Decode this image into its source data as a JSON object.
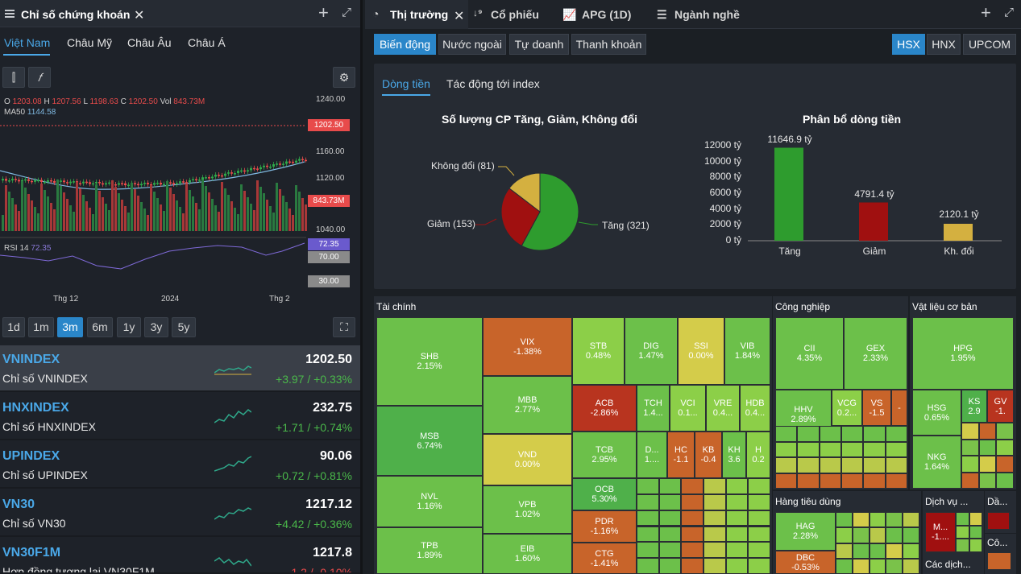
{
  "left_panel": {
    "title": "Chỉ số chứng khoán",
    "regions": [
      "Việt Nam",
      "Châu Mỹ",
      "Châu Âu",
      "Châu Á"
    ],
    "chart": {
      "legend_o_label": "O",
      "legend_o": "1203.08",
      "legend_h_label": "H",
      "legend_h": "1207.56",
      "legend_l_label": "L",
      "legend_l": "1198.63",
      "legend_c_label": "C",
      "legend_c": "1202.50",
      "legend_vol_label": "Vol",
      "legend_vol": "843.73M",
      "ma50_label": "MA50",
      "ma50": "1144.58",
      "rsi_label": "RSI 14",
      "rsi": "72.35",
      "y_ticks": [
        "1240.00",
        "1160.00",
        "1120.00",
        "1040.00"
      ],
      "price_tag": "1202.50",
      "vol_tag": "843.73M",
      "rsi_tag": "72.35",
      "rsi_70": "70.00",
      "rsi_30": "30.00",
      "x_ticks": [
        "Thg 12",
        "2024",
        "Thg 2"
      ]
    },
    "ranges": [
      "1d",
      "1m",
      "3m",
      "6m",
      "1y",
      "3y",
      "5y"
    ],
    "indices": [
      {
        "code": "VNINDEX",
        "name": "Chỉ số VNINDEX",
        "value": "1202.50",
        "change": "+3.97 / +0.33%",
        "dir": "up"
      },
      {
        "code": "HNXINDEX",
        "name": "Chỉ số HNXINDEX",
        "value": "232.75",
        "change": "+1.71 / +0.74%",
        "dir": "up"
      },
      {
        "code": "UPINDEX",
        "name": "Chỉ số UPINDEX",
        "value": "90.06",
        "change": "+0.72 / +0.81%",
        "dir": "up"
      },
      {
        "code": "VN30",
        "name": "Chỉ số VN30",
        "value": "1217.12",
        "change": "+4.42 / +0.36%",
        "dir": "up"
      },
      {
        "code": "VN30F1M",
        "name": "Hợp đồng tương lai VN30F1M",
        "value": "1217.8",
        "change": "-1.2 / -0.10%",
        "dir": "down"
      }
    ]
  },
  "right_panel": {
    "tabs": [
      "Thị trường",
      "Cổ phiếu",
      "APG (1D)",
      "Ngành nghề"
    ],
    "sub_tabs": [
      "Biến động",
      "Nước ngoài",
      "Tự doanh",
      "Thanh khoản"
    ],
    "exchanges": [
      "HSX",
      "HNX",
      "UPCOM"
    ],
    "inner_tabs": [
      "Dòng tiền",
      "Tác động tới index"
    ],
    "pie_title": "Số lượng CP Tăng, Giảm, Không đổi",
    "bar_title": "Phân bổ dòng tiền",
    "pie_labels": {
      "nochange": "Không đổi (81)",
      "down": "Giảm (153)",
      "up": "Tăng (321)"
    },
    "bar_y_ticks": [
      "12000 tỷ",
      "10000 tỷ",
      "8000 tỷ",
      "6000 tỷ",
      "4000 tỷ",
      "2000 tỷ",
      "0 tỷ"
    ],
    "bar_value_labels": [
      "11646.9 tỷ",
      "4791.4 tỷ",
      "2120.1 tỷ"
    ],
    "bar_categories": [
      "Tăng",
      "Giảm",
      "Kh. đổi"
    ],
    "treemap_sections": [
      "Tài chính",
      "Công nghiệp",
      "Vật liệu cơ bản",
      "Hàng tiêu dùng",
      "Dịch vụ ...",
      "Dầ...",
      "Cô...",
      "Các dịch..."
    ],
    "tiles": [
      {
        "code": "SHB",
        "pct": "2.15%"
      },
      {
        "code": "MSB",
        "pct": "6.74%"
      },
      {
        "code": "NVL",
        "pct": "1.16%"
      },
      {
        "code": "TPB",
        "pct": "1.89%"
      },
      {
        "code": "VIX",
        "pct": "-1.38%"
      },
      {
        "code": "MBB",
        "pct": "2.77%"
      },
      {
        "code": "VND",
        "pct": "0.00%"
      },
      {
        "code": "VPB",
        "pct": "1.02%"
      },
      {
        "code": "EIB",
        "pct": "1.60%"
      },
      {
        "code": "STB",
        "pct": "0.48%"
      },
      {
        "code": "DIG",
        "pct": "1.47%"
      },
      {
        "code": "SSI",
        "pct": "0.00%"
      },
      {
        "code": "VIB",
        "pct": "1.84%"
      },
      {
        "code": "ACB",
        "pct": "-2.86%"
      },
      {
        "code": "TCB",
        "pct": "2.95%"
      },
      {
        "code": "OCB",
        "pct": "5.30%"
      },
      {
        "code": "PDR",
        "pct": "-1.16%"
      },
      {
        "code": "CTG",
        "pct": "-1.41%"
      },
      {
        "code": "TCH",
        "pct": "1.4..."
      },
      {
        "code": "VCI",
        "pct": "0.1..."
      },
      {
        "code": "VRE",
        "pct": "0.4..."
      },
      {
        "code": "HDB",
        "pct": "0.4..."
      },
      {
        "code": "D...",
        "pct": "1...."
      },
      {
        "code": "HC",
        "pct": "-1.1"
      },
      {
        "code": "KB",
        "pct": "-0.4"
      },
      {
        "code": "KH",
        "pct": "3.6"
      },
      {
        "code": "H",
        "pct": "0.2"
      },
      {
        "code": "CII",
        "pct": "4.35%"
      },
      {
        "code": "GEX",
        "pct": "2.33%"
      },
      {
        "code": "HHV",
        "pct": "2.89%"
      },
      {
        "code": "VCG",
        "pct": "0.2..."
      },
      {
        "code": "VS",
        "pct": "-1.5"
      },
      {
        "code": "-",
        "pct": ""
      },
      {
        "code": "HPG",
        "pct": "1.95%"
      },
      {
        "code": "HSG",
        "pct": "0.65%"
      },
      {
        "code": "KS",
        "pct": "2.9"
      },
      {
        "code": "GV",
        "pct": "-1."
      },
      {
        "code": "NKG",
        "pct": "1.64%"
      },
      {
        "code": "HAG",
        "pct": "2.28%"
      },
      {
        "code": "DBC",
        "pct": "-0.53%"
      },
      {
        "code": "M...",
        "pct": "-1...."
      }
    ]
  },
  "chart_data": [
    {
      "type": "pie",
      "title": "Số lượng CP Tăng, Giảm, Không đổi",
      "categories": [
        "Tăng",
        "Giảm",
        "Không đổi"
      ],
      "values": [
        321,
        153,
        81
      ],
      "colors": [
        "#2e9c2e",
        "#a01010",
        "#d4b040"
      ]
    },
    {
      "type": "bar",
      "title": "Phân bổ dòng tiền",
      "categories": [
        "Tăng",
        "Giảm",
        "Kh. đổi"
      ],
      "values": [
        11646.9,
        4791.4,
        2120.1
      ],
      "ylim": [
        0,
        12000
      ],
      "colors": [
        "#2e9c2e",
        "#a01010",
        "#d4b040"
      ]
    }
  ]
}
